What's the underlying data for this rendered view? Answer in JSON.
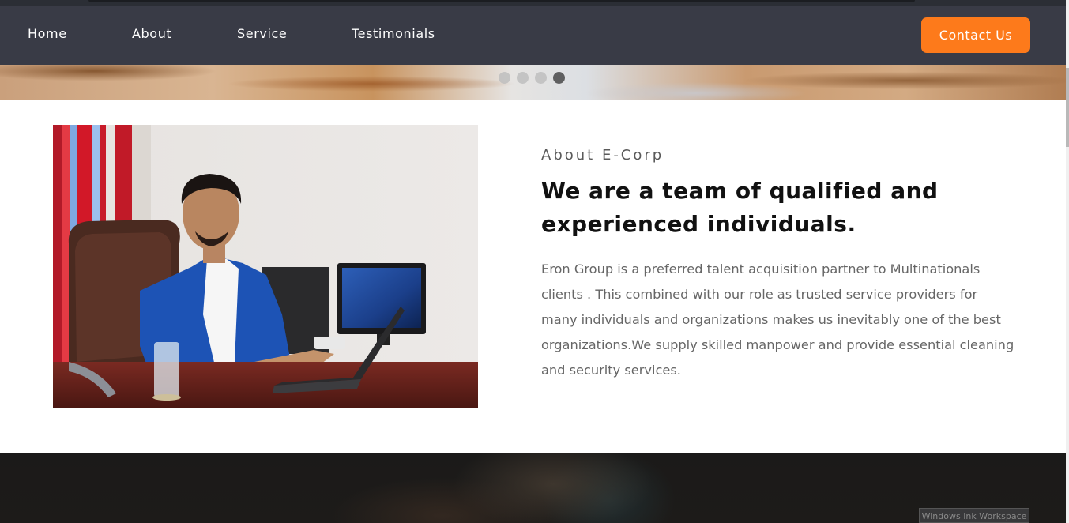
{
  "nav": {
    "items": [
      {
        "label": "Home"
      },
      {
        "label": "About"
      },
      {
        "label": "Service"
      },
      {
        "label": "Testimonials"
      }
    ],
    "contact_label": "Contact Us"
  },
  "slider": {
    "slide_count": 4,
    "active_index": 3
  },
  "about": {
    "eyebrow": "About E-Corp",
    "headline_line1": "We are a team of qualified and",
    "headline_line2": "experienced individuals.",
    "description": "Eron Group is a preferred talent acquisition partner to Multinationals clients . This combined with our role as trusted service providers for many individuals and organizations makes us inevitably one of the best organizations.We supply skilled manpower and provide essential cleaning and security services."
  },
  "system": {
    "ink_workspace_label": "Windows Ink Workspace"
  },
  "colors": {
    "navbar_bg": "#393b46",
    "accent": "#fd7a1b",
    "headline": "#111111",
    "body_text": "#666666"
  },
  "icons": {
    "photo": "office-man-portrait-image"
  }
}
